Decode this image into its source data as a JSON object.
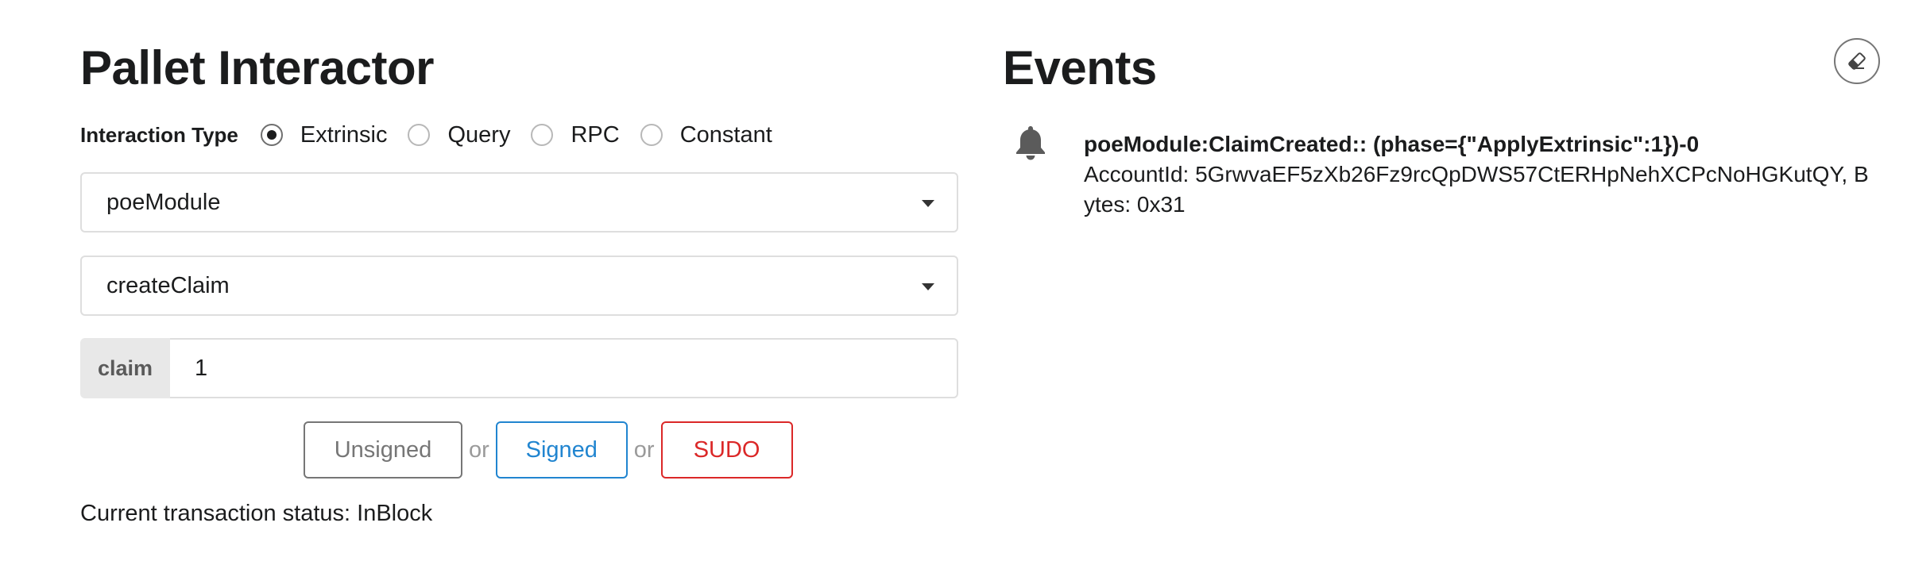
{
  "pallet": {
    "title": "Pallet Interactor",
    "interaction_type_label": "Interaction Type",
    "interaction_types": [
      {
        "label": "Extrinsic",
        "checked": true
      },
      {
        "label": "Query",
        "checked": false
      },
      {
        "label": "RPC",
        "checked": false
      },
      {
        "label": "Constant",
        "checked": false
      }
    ],
    "pallet_select": {
      "value": "poeModule"
    },
    "callable_select": {
      "value": "createClaim"
    },
    "param": {
      "label": "claim",
      "value": "1"
    },
    "buttons": {
      "unsigned": "Unsigned",
      "signed": "Signed",
      "sudo": "SUDO",
      "or": "or"
    },
    "status": "Current transaction status: InBlock"
  },
  "events": {
    "title": "Events",
    "items": [
      {
        "icon": "bell-icon",
        "summary": "poeModule:ClaimCreated:: (phase={\"ApplyExtrinsic\":1})-0",
        "description": "AccountId: 5GrwvaEF5zXb26Fz9rcQpDWS57CtERHpNehXCPcNoHGKutQY, Bytes: 0x31"
      }
    ],
    "clear_icon": "eraser-icon"
  },
  "colors": {
    "signed": "#2185d0",
    "sudo": "#db2828",
    "unsigned": "#767676"
  }
}
